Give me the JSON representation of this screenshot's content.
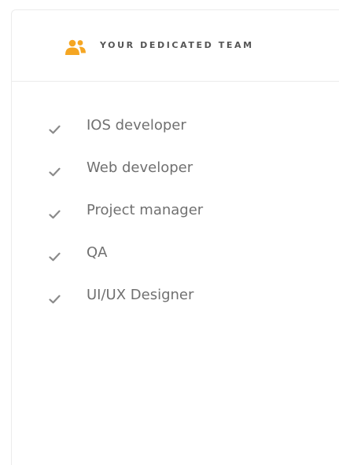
{
  "panel": {
    "title": "YOUR DEDICATED TEAM",
    "title_icon": "team-icon",
    "accent_color": "#f5a623"
  },
  "roles": [
    {
      "label": "IOS developer",
      "icon": "check-icon"
    },
    {
      "label": "Web developer",
      "icon": "check-icon"
    },
    {
      "label": "Project manager",
      "icon": "check-icon"
    },
    {
      "label": "QA",
      "icon": "check-icon"
    },
    {
      "label": "UI/UX Designer",
      "icon": "check-icon"
    }
  ]
}
